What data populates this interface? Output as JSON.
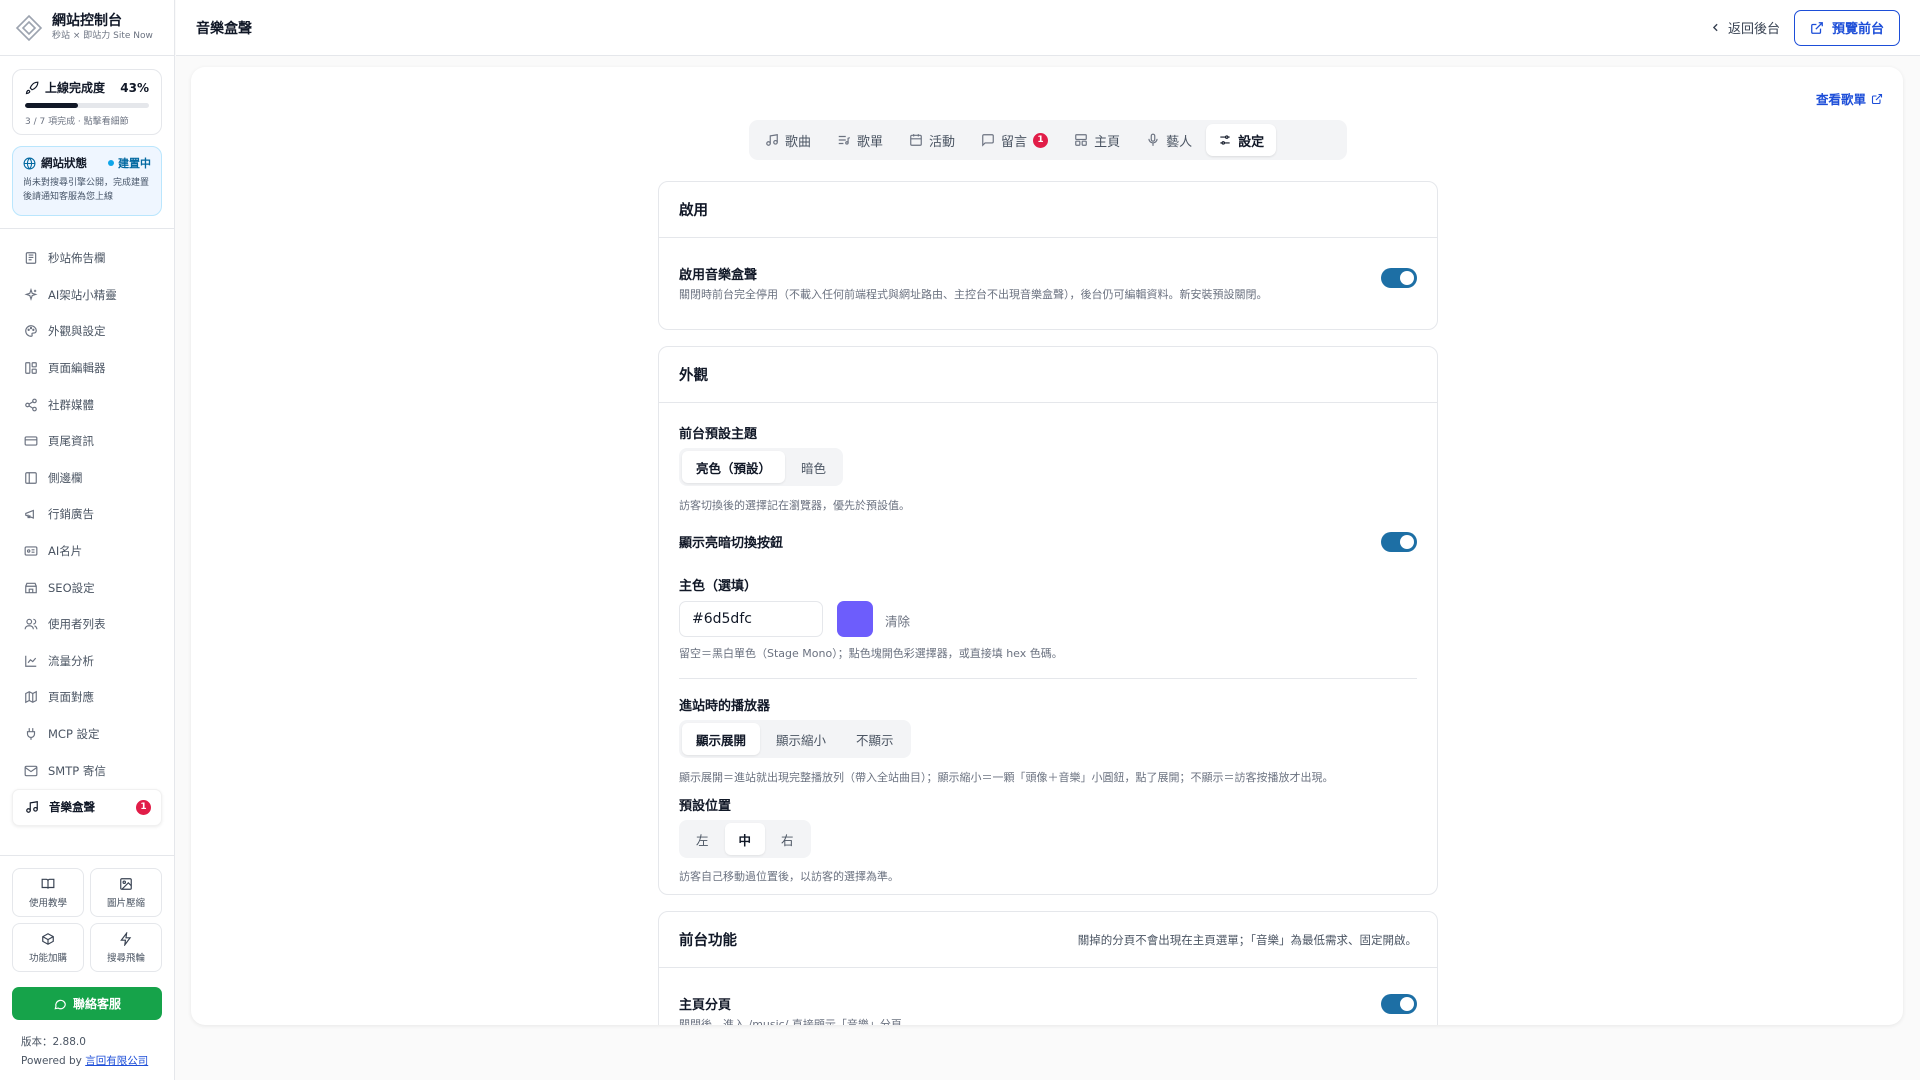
{
  "brand": {
    "title": "網站控制台",
    "subtitle": "秒站 × 即站力 Site Now"
  },
  "progress": {
    "label": "上線完成度",
    "percent_text": "43%",
    "fraction": 0.43,
    "note": "3 / 7 項完成 · 點擊看細節"
  },
  "status": {
    "label": "網站狀態",
    "badge": "建置中",
    "note": "尚未對搜尋引擎公開，完成建置後請通知客服為您上線"
  },
  "nav": [
    {
      "label": "秒站佈告欄",
      "icon": "newspaper-icon"
    },
    {
      "label": "AI架站小精靈",
      "icon": "sparkles-icon"
    },
    {
      "label": "外觀與設定",
      "icon": "palette-icon"
    },
    {
      "label": "頁面編輯器",
      "icon": "layout-icon"
    },
    {
      "label": "社群媒體",
      "icon": "share-icon"
    },
    {
      "label": "頁尾資訊",
      "icon": "card-icon"
    },
    {
      "label": "側邊欄",
      "icon": "sidebar-icon"
    },
    {
      "label": "行銷廣告",
      "icon": "megaphone-icon"
    },
    {
      "label": "AI名片",
      "icon": "id-card-icon"
    },
    {
      "label": "SEO設定",
      "icon": "store-icon"
    },
    {
      "label": "使用者列表",
      "icon": "users-icon"
    },
    {
      "label": "流量分析",
      "icon": "chart-line-icon"
    },
    {
      "label": "頁面對應",
      "icon": "map-icon"
    },
    {
      "label": "MCP 設定",
      "icon": "plug-icon"
    },
    {
      "label": "SMTP 寄信",
      "icon": "mail-icon"
    },
    {
      "label": "音樂盒聲",
      "icon": "music-icon",
      "badge": "1"
    }
  ],
  "tools": [
    {
      "label": "使用教學",
      "icon": "book-icon"
    },
    {
      "label": "圖片壓縮",
      "icon": "image-icon"
    },
    {
      "label": "功能加購",
      "icon": "box-icon"
    },
    {
      "label": "搜尋飛輪",
      "icon": "zap-icon"
    }
  ],
  "contact_label": "聯絡客服",
  "version_text": "版本：2.88.0",
  "powered_prefix": "Powered by ",
  "powered_company": "言回有限公司",
  "topbar": {
    "title": "音樂盒聲",
    "back_label": "返回後台",
    "preview_label": "預覽前台"
  },
  "view_playlist": "查看歌單",
  "tabs": [
    {
      "label": "歌曲",
      "icon": "music-note-icon"
    },
    {
      "label": "歌單",
      "icon": "list-music-icon"
    },
    {
      "label": "活動",
      "icon": "calendar-icon"
    },
    {
      "label": "留言",
      "icon": "message-icon",
      "badge": "1"
    },
    {
      "label": "主頁",
      "icon": "layout-grid-icon"
    },
    {
      "label": "藝人",
      "icon": "mic-icon"
    },
    {
      "label": "設定",
      "icon": "sliders-icon",
      "active": true
    }
  ],
  "enable_section": {
    "title": "啟用",
    "field_title": "啟用音樂盒聲",
    "field_desc": "關閉時前台完全停用（不載入任何前端程式與網址路由、主控台不出現音樂盒聲），後台仍可編輯資料。新安裝預設關閉。",
    "enabled": true
  },
  "appearance": {
    "title": "外觀",
    "theme_label": "前台預設主題",
    "theme_options": [
      "亮色（預設）",
      "暗色"
    ],
    "theme_desc": "訪客切換後的選擇記在瀏覽器，優先於預設值。",
    "toggle_label": "顯示亮暗切換按鈕",
    "toggle_on": true,
    "color_label": "主色（選填）",
    "color_value": "#6d5dfc",
    "clear_label": "清除",
    "color_desc": "留空＝黑白單色（Stage Mono）；點色塊開色彩選擇器，或直接填 hex 色碼。",
    "player_label": "進站時的播放器",
    "player_options": [
      "顯示展開",
      "顯示縮小",
      "不顯示"
    ],
    "player_desc": "顯示展開＝進站就出現完整播放列（帶入全站曲目）；顯示縮小＝一顆「頭像＋音樂」小圓鈕，點了展開；不顯示＝訪客按播放才出現。",
    "position_label": "預設位置",
    "position_options": [
      "左",
      "中",
      "右"
    ],
    "position_desc": "訪客自己移動過位置後，以訪客的選擇為準。"
  },
  "frontend": {
    "title": "前台功能",
    "desc": "關掉的分頁不會出現在主頁選單；「音樂」為最低需求、固定開啟。",
    "field_title": "主頁分頁",
    "field_desc": "關閉後，進入 /music/ 直接顯示「音樂」分頁。",
    "enabled": true
  },
  "colors": {
    "accent": "#1d6fa5",
    "link": "#1d4ed8",
    "contact": "#16a34a",
    "badge": "#e11d48",
    "swatch": "#6d5dfc"
  }
}
